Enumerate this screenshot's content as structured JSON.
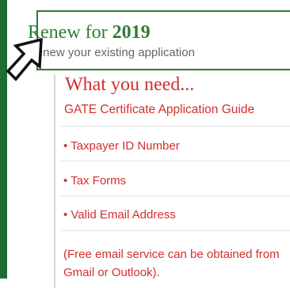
{
  "renew": {
    "title_prefix": "Renew for ",
    "year": "2019",
    "subtitle": "Renew your existing application"
  },
  "requirements": {
    "heading": "What you need...",
    "guide_link": "GATE Certificate Application Guide",
    "items": [
      "• Taxpayer ID Number",
      "• Tax Forms",
      "• Valid Email Address"
    ],
    "note": "(Free email service can be obtained from Gmail or Outlook)."
  },
  "colors": {
    "green": "#2e7d32",
    "frame_green": "#1e6b34",
    "red": "#d32f2f"
  },
  "icons": {
    "cursor": "pointer-arrow-icon"
  }
}
